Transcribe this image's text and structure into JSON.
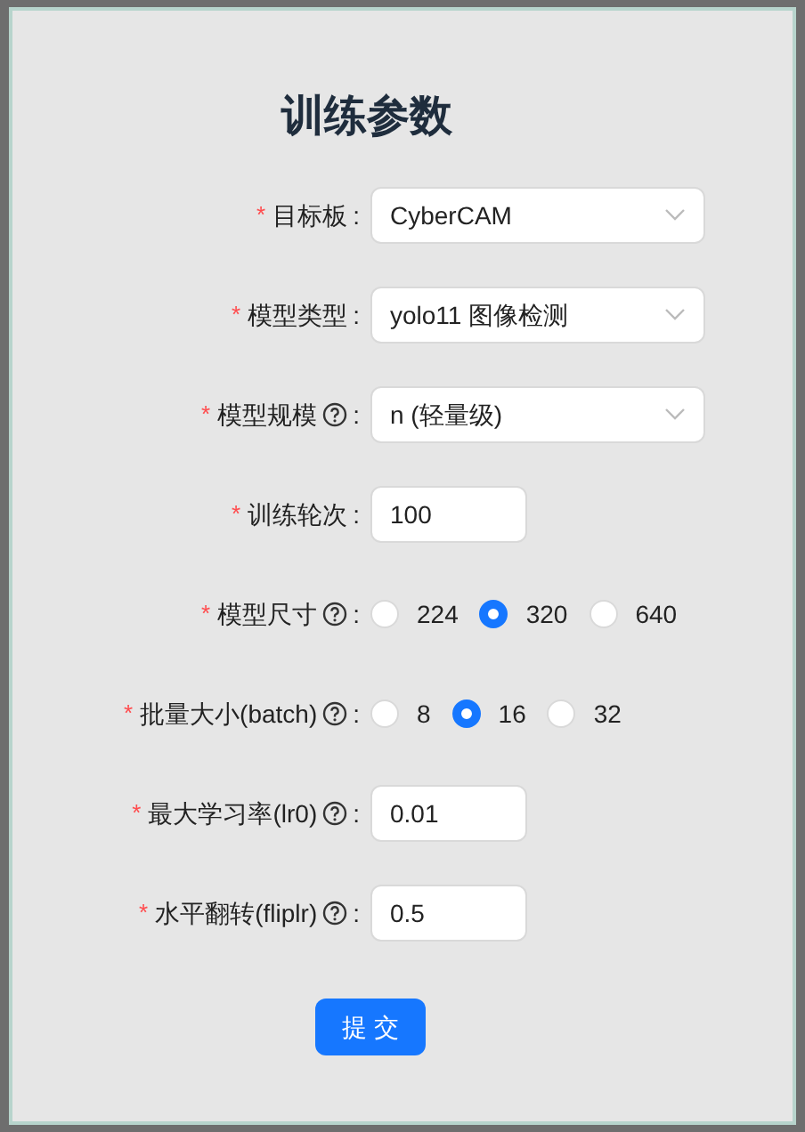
{
  "title": "训练参数",
  "fields": [
    {
      "kind": "select",
      "required_mark": "*",
      "label": "目标板",
      "help": false,
      "suffix": ":",
      "value": "CyberCAM"
    },
    {
      "kind": "select",
      "required_mark": "*",
      "label": "模型类型",
      "help": false,
      "suffix": ":",
      "value": "yolo11 图像检测"
    },
    {
      "kind": "select",
      "required_mark": "*",
      "label": "模型规模",
      "help": true,
      "suffix": ":",
      "value": "n (轻量级)"
    },
    {
      "kind": "input",
      "required_mark": "*",
      "label": "训练轮次",
      "help": false,
      "suffix": ":",
      "value": "100"
    },
    {
      "kind": "radio",
      "required_mark": "*",
      "label": "模型尺寸",
      "help": true,
      "suffix": ":",
      "options": [
        {
          "label": "224",
          "selected": false
        },
        {
          "label": "320",
          "selected": true
        },
        {
          "label": "640",
          "selected": false
        }
      ]
    },
    {
      "kind": "radio",
      "required_mark": "*",
      "label": "批量大小(batch)",
      "help": true,
      "suffix": ":",
      "options": [
        {
          "label": "8",
          "selected": false
        },
        {
          "label": "16",
          "selected": true
        },
        {
          "label": "32",
          "selected": false
        }
      ]
    },
    {
      "kind": "input",
      "required_mark": "*",
      "label": "最大学习率(lr0)",
      "help": true,
      "suffix": ":",
      "value": "0.01"
    },
    {
      "kind": "input",
      "required_mark": "*",
      "label": "水平翻转(fliplr)",
      "help": true,
      "suffix": ":",
      "value": "0.5"
    }
  ],
  "submit": "提 交"
}
